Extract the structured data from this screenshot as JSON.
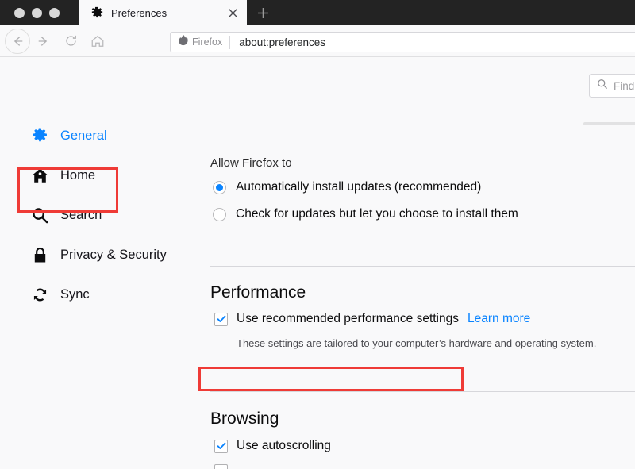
{
  "window": {
    "controls": [
      "close",
      "minimize",
      "maximize"
    ]
  },
  "tabs": {
    "active": {
      "title": "Preferences",
      "icon": "gear-icon",
      "close_label": "✕"
    },
    "new_tab_label": "+"
  },
  "toolbar": {
    "back_label": "←",
    "forward_label": "→",
    "reload_label": "⟳",
    "home_label": "⌂"
  },
  "urlbar": {
    "identity_label": "Firefox",
    "url": "about:preferences"
  },
  "search": {
    "placeholder": "Find"
  },
  "sidebar": {
    "items": [
      {
        "label": "General",
        "icon": "gear-icon",
        "selected": true
      },
      {
        "label": "Home",
        "icon": "home-icon",
        "selected": false
      },
      {
        "label": "Search",
        "icon": "magnifier-icon",
        "selected": false
      },
      {
        "label": "Privacy & Security",
        "icon": "lock-icon",
        "selected": false
      },
      {
        "label": "Sync",
        "icon": "sync-icon",
        "selected": false
      }
    ]
  },
  "main": {
    "updates": {
      "group_label": "Allow Firefox to",
      "options": [
        {
          "label": "Automatically install updates (recommended)",
          "checked": true
        },
        {
          "label": "Check for updates but let you choose to install them",
          "checked": false
        }
      ]
    },
    "performance": {
      "title": "Performance",
      "checkbox_label": "Use recommended performance settings",
      "checkbox_checked": true,
      "learn_more": "Learn more",
      "hint": "These settings are tailored to your computer’s hardware and operating system."
    },
    "browsing": {
      "title": "Browsing",
      "options": [
        {
          "label": "Use autoscrolling",
          "checked": true
        }
      ]
    }
  },
  "annotations": {
    "highlight_color": "#ef3b36",
    "boxes": [
      "sidebar-general",
      "performance-checkbox-row"
    ]
  },
  "colors": {
    "accent": "#0a84ff",
    "page_bg": "#f9f9fa",
    "titlebar_bg": "#232323",
    "highlight": "#ef3b36"
  }
}
